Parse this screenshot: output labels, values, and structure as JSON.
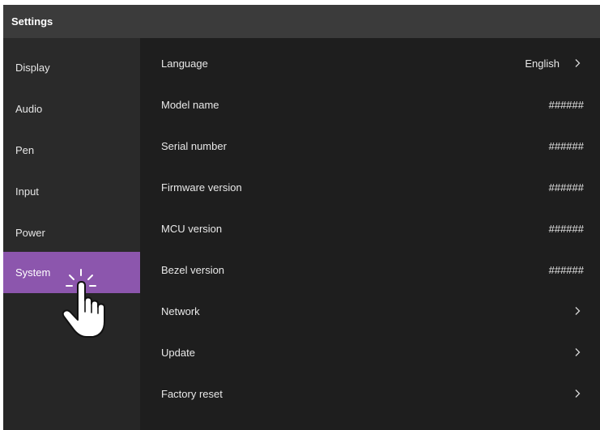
{
  "titlebar": {
    "title": "Settings"
  },
  "sidebar": {
    "items": [
      {
        "label": "Display"
      },
      {
        "label": "Audio"
      },
      {
        "label": "Pen"
      },
      {
        "label": "Input"
      },
      {
        "label": "Power"
      },
      {
        "label": "System",
        "selected": true
      }
    ]
  },
  "system": {
    "rows": [
      {
        "label": "Language",
        "value": "English",
        "chevron": true
      },
      {
        "label": "Model name",
        "value": "######"
      },
      {
        "label": "Serial number",
        "value": "######"
      },
      {
        "label": "Firmware version",
        "value": "######"
      },
      {
        "label": "MCU version",
        "value": "######"
      },
      {
        "label": "Bezel version",
        "value": "######"
      },
      {
        "label": "Network",
        "chevron": true
      },
      {
        "label": "Update",
        "chevron": true
      },
      {
        "label": "Factory reset",
        "chevron": true
      }
    ]
  },
  "colors": {
    "accent": "#8c56ad",
    "titlebar": "#3b3b3b",
    "sidebar": "#2a2a2a",
    "content": "#1e1e1e"
  },
  "icons": {
    "pointer": "tap-hand-icon",
    "chevron": "chevron-right-icon"
  }
}
